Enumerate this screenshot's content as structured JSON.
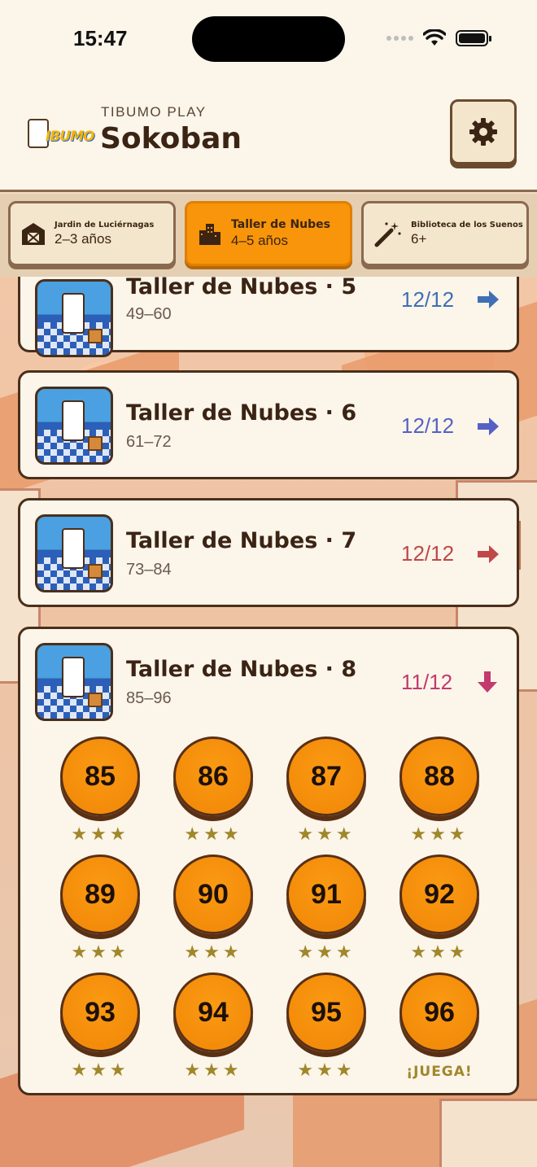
{
  "status_bar": {
    "time": "15:47"
  },
  "header": {
    "logo_text": "IBUMO",
    "brand": "TIBUMO PLAY",
    "title": "Sokoban",
    "settings_icon": "gear-icon"
  },
  "tabs": [
    {
      "icon": "barn-icon",
      "name": "Jardin de Luciérnagas",
      "age": "2–3 años",
      "active": false
    },
    {
      "icon": "buildings-icon",
      "name": "Taller de Nubes",
      "age": "4–5 años",
      "active": true
    },
    {
      "icon": "magic-wand-icon",
      "name": "Biblioteca de los Suenos",
      "age": "6+",
      "active": false
    }
  ],
  "worlds": [
    {
      "title": "Taller de Nubes · 5",
      "range": "49–60",
      "progress": "12/12",
      "color": "#3f6fb5",
      "arrow": "arrow-right-icon"
    },
    {
      "title": "Taller de Nubes · 6",
      "range": "61–72",
      "progress": "12/12",
      "color": "#5562c4",
      "arrow": "arrow-right-icon"
    },
    {
      "title": "Taller de Nubes · 7",
      "range": "73–84",
      "progress": "12/12",
      "color": "#c04848",
      "arrow": "arrow-right-icon"
    },
    {
      "title": "Taller de Nubes · 8",
      "range": "85–96",
      "progress": "11/12",
      "color": "#c23a6e",
      "arrow": "arrow-down-icon"
    }
  ],
  "levels": [
    {
      "number": "85",
      "stars": 3,
      "label": ""
    },
    {
      "number": "86",
      "stars": 3,
      "label": ""
    },
    {
      "number": "87",
      "stars": 3,
      "label": ""
    },
    {
      "number": "88",
      "stars": 3,
      "label": ""
    },
    {
      "number": "89",
      "stars": 3,
      "label": ""
    },
    {
      "number": "90",
      "stars": 3,
      "label": ""
    },
    {
      "number": "91",
      "stars": 3,
      "label": ""
    },
    {
      "number": "92",
      "stars": 3,
      "label": ""
    },
    {
      "number": "93",
      "stars": 3,
      "label": ""
    },
    {
      "number": "94",
      "stars": 3,
      "label": ""
    },
    {
      "number": "95",
      "stars": 3,
      "label": ""
    },
    {
      "number": "96",
      "stars": 0,
      "label": "¡JUEGA!"
    }
  ],
  "colors": {
    "accent": "#f9950a",
    "star": "#a0872a",
    "card_border": "#4a2f1a"
  }
}
